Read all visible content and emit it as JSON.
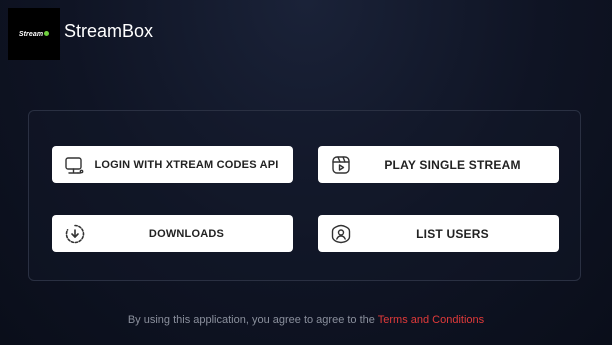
{
  "app": {
    "logo_text": "Stream",
    "title": "StreamBox"
  },
  "buttons": {
    "login": {
      "label": "LOGIN WITH XTREAM CODES API",
      "icon": "monitor-network-icon"
    },
    "play": {
      "label": "PLAY SINGLE STREAM",
      "icon": "video-play-icon"
    },
    "downloads": {
      "label": "DOWNLOADS",
      "icon": "download-circle-icon"
    },
    "users": {
      "label": "LIST USERS",
      "icon": "user-profile-icon"
    }
  },
  "footer": {
    "text": "By using this application, you agree to agree to the",
    "link": "Terms and Conditions"
  },
  "colors": {
    "background": "#0f1424",
    "button_bg": "#ffffff",
    "link": "#e03a3a",
    "logo_accent": "#6fcf3f"
  }
}
